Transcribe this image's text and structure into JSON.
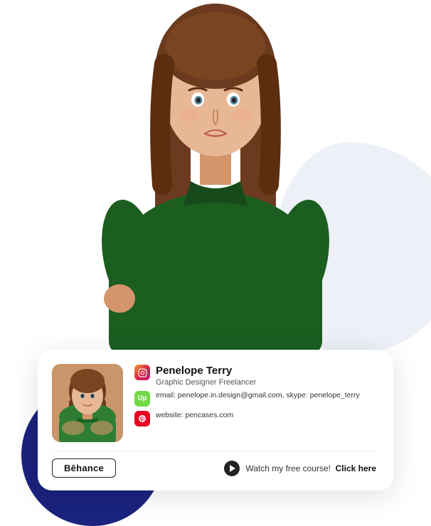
{
  "person": {
    "name": "Penelope Terry",
    "role": "Graphic Designer Freelancer",
    "email": "penelope.in.design@gmail.com",
    "skype": "penelope_terry",
    "website": "pencases.com",
    "contact_line": "email:  penelope.in.design@gmail.com, skype:  penelope_terry",
    "website_line": "website: pencases.com"
  },
  "card": {
    "behance_label": "Bēhance",
    "watch_text": "Watch my free course!",
    "click_text": "Click here"
  },
  "social": {
    "instagram_letter": "◻",
    "upwork_letter": "Up",
    "pinterest_letter": "P"
  }
}
